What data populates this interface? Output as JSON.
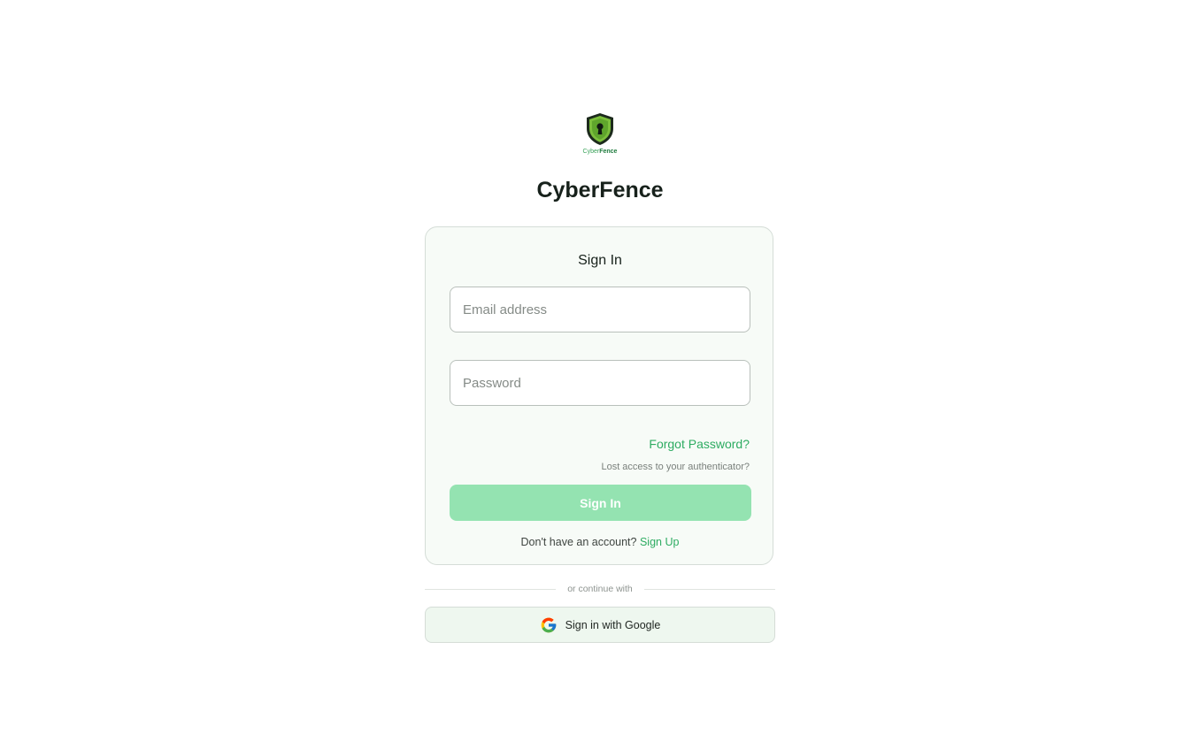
{
  "brand": {
    "logo_text_part1": "Cyber",
    "logo_text_part2": "Fence",
    "app_title": "CyberFence",
    "primary_color": "#2eac62",
    "logo_icon": "shield-keyhole-icon"
  },
  "signin_card": {
    "title": "Sign In",
    "email_placeholder": "Email address",
    "password_placeholder": "Password",
    "forgot_password_label": "Forgot Password?",
    "lost_authenticator_label": "Lost access to your authenticator?",
    "signin_button_label": "Sign In",
    "no_account_text": "Don't have an account?",
    "signup_link_label": "Sign Up"
  },
  "alternate_signin": {
    "divider_text": "or continue with",
    "google_button_label": "Sign in with Google",
    "google_icon": "google-icon"
  }
}
